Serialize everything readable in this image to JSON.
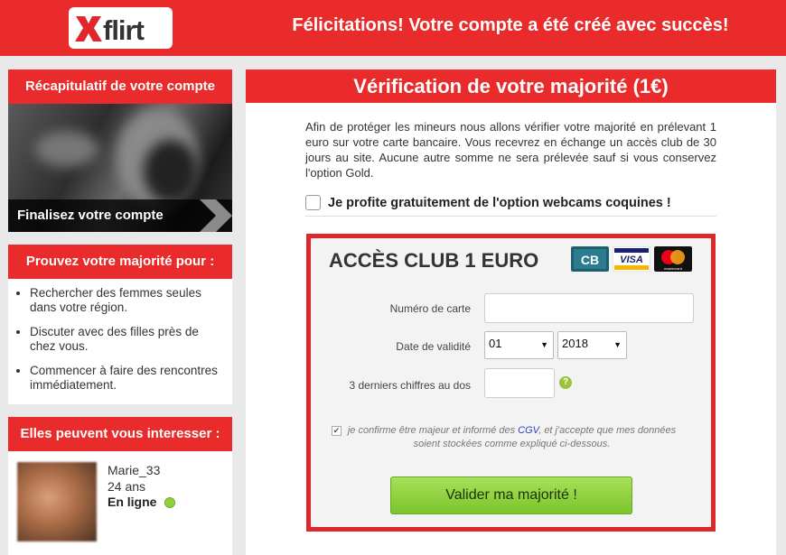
{
  "header": {
    "logo_text": "xflirt",
    "message": "Félicitations! Votre compte a été créé avec succès!"
  },
  "sidebar": {
    "summary": {
      "title": "Récapitulatif de votre compte",
      "cta": "Finalisez votre compte"
    },
    "prove": {
      "title": "Prouvez votre majorité pour :",
      "items": [
        "Rechercher des femmes seules dans votre région.",
        "Discuter avec des filles près de chez vous.",
        "Commencer à faire des rencontres immédiatement."
      ]
    },
    "interest": {
      "title": "Elles peuvent vous interesser :",
      "profile": {
        "name": "Marie_33",
        "age": "24 ans",
        "status": "En ligne"
      }
    }
  },
  "main": {
    "title": "Vérification de votre majorité (1€)",
    "description": "Afin de protéger les mineurs nous allons vérifier votre majorité en prélevant 1 euro sur votre carte bancaire. Vous recevrez en échange un accès club de 30 jours au site. Aucune autre somme ne sera prélevée sauf si vous conservez l'option Gold.",
    "webcam_option": "Je profite gratuitement de l'option webcams coquines !",
    "payment": {
      "title": "ACCÈS CLUB 1 EURO",
      "card_logos": [
        "CB",
        "VISA",
        "mastercard"
      ],
      "card_number_label": "Numéro de carte",
      "card_number_value": "",
      "expiry_label": "Date de validité",
      "expiry_month": "01",
      "expiry_year": "2018",
      "cvv_label": "3 derniers chiffres au dos",
      "cvv_value": "",
      "help_icon": "?",
      "confirm_before": "je confirme être majeur et informé des ",
      "confirm_link": "CGV",
      "confirm_after": ", et j'accepte que mes données soient stockées comme expliqué ci-dessous.",
      "submit": "Valider ma majorité !"
    }
  },
  "colors": {
    "brand_red": "#ea2b2b",
    "button_green": "#8fd13a",
    "online_dot": "#8fd13a"
  }
}
